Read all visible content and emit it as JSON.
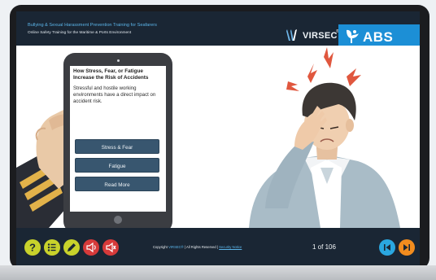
{
  "header": {
    "title": "Bullying & Sexual Harassment Prevention Training for Seafarers",
    "subtitle": "Online Safety Training for the Maritime & Ports Environment",
    "logo_virsec": "VIRSEC",
    "logo_virsec_mark": "®",
    "logo_abs": "ABS"
  },
  "tablet": {
    "title": "How Stress, Fear, or Fatigue Increase the Risk of Accidents",
    "body": "Stressful and hostile working environments have a direct impact on accident risk.",
    "buttons": [
      "Stress & Fear",
      "Fatigue",
      "Read More"
    ]
  },
  "footer": {
    "copyright_prefix": "Copyright",
    "brand": "VIRSEC®",
    "rights": "| All Rights Reserved |",
    "link": "Security Notice",
    "page": "1 of 106"
  },
  "colors": {
    "header_bg": "#1a2634",
    "header_title": "#5bb4e8",
    "abs_blue": "#1c8fd6",
    "tablet_button": "#38566f",
    "help_yellow": "#c8d22b",
    "nav_red": "#d63a3a",
    "prev_blue": "#2aa7e0",
    "next_orange": "#f28c1e"
  },
  "icons": [
    "help-icon",
    "menu-list-icon",
    "pencil-icon",
    "audio-icon",
    "audio-mute-icon",
    "previous-icon",
    "next-icon"
  ]
}
